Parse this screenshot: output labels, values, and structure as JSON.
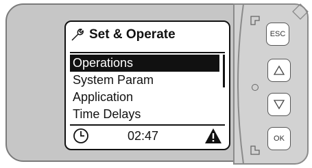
{
  "header": {
    "title": "Set & Operate",
    "icon": "wrench-icon"
  },
  "menu": {
    "items": [
      {
        "label": "Operations",
        "selected": true
      },
      {
        "label": "System Param",
        "selected": false
      },
      {
        "label": "Application",
        "selected": false
      },
      {
        "label": "Time Delays",
        "selected": false
      }
    ]
  },
  "status": {
    "time": "02:47",
    "clock_icon": "clock-icon",
    "alert_icon": "warning-icon"
  },
  "keys": {
    "esc": "ESC",
    "ok": "OK",
    "up": "up-arrow-icon",
    "down": "down-arrow-icon"
  }
}
